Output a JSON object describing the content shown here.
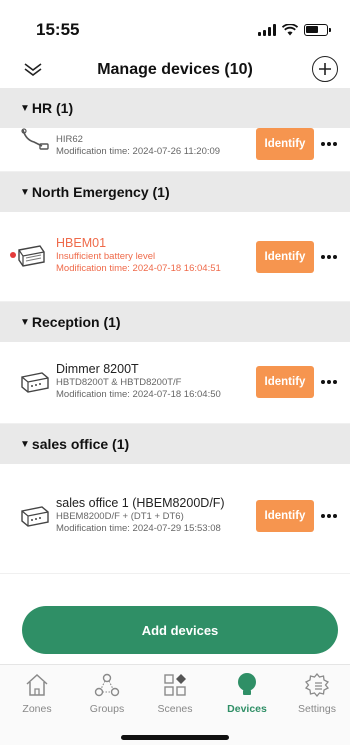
{
  "status_bar": {
    "time": "15:55"
  },
  "header": {
    "title": "Manage devices (10)"
  },
  "groups": [
    {
      "title": "HR (1)",
      "devices": [
        {
          "name": "",
          "line1": "HIR62",
          "line2": "Modification time: 2024-07-26 11:20:09",
          "identify": "Identify",
          "warning": false
        }
      ]
    },
    {
      "title": "North Emergency (1)",
      "devices": [
        {
          "name": "HBEM01",
          "line1": "Insufficient battery level",
          "line2": "Modification time: 2024-07-18 16:04:51",
          "identify": "Identify",
          "warning": true
        }
      ]
    },
    {
      "title": "Reception (1)",
      "devices": [
        {
          "name": "Dimmer 8200T",
          "line1": "HBTD8200T & HBTD8200T/F",
          "line2": "Modification time: 2024-07-18 16:04:50",
          "identify": "Identify",
          "warning": false
        }
      ]
    },
    {
      "title": "sales office (1)",
      "devices": [
        {
          "name": "sales office 1 (HBEM8200D/F)",
          "line1": "HBEM8200D/F + (DT1 + DT6)",
          "line2": "Modification time: 2024-07-29 15:53:08",
          "identify": "Identify",
          "warning": false
        }
      ]
    }
  ],
  "primary_action": {
    "label": "Add devices"
  },
  "tabs": [
    {
      "label": "Zones",
      "icon": "house-icon",
      "active": false
    },
    {
      "label": "Groups",
      "icon": "groups-icon",
      "active": false
    },
    {
      "label": "Scenes",
      "icon": "scenes-icon",
      "active": false
    },
    {
      "label": "Devices",
      "icon": "bulb-icon",
      "active": true
    },
    {
      "label": "Settings",
      "icon": "settings-icon",
      "active": false
    }
  ],
  "colors": {
    "accent": "#2f8f66",
    "identify": "#f6954f",
    "warning_text": "#ef6a4a",
    "group_header_bg": "#e9e9e9"
  }
}
